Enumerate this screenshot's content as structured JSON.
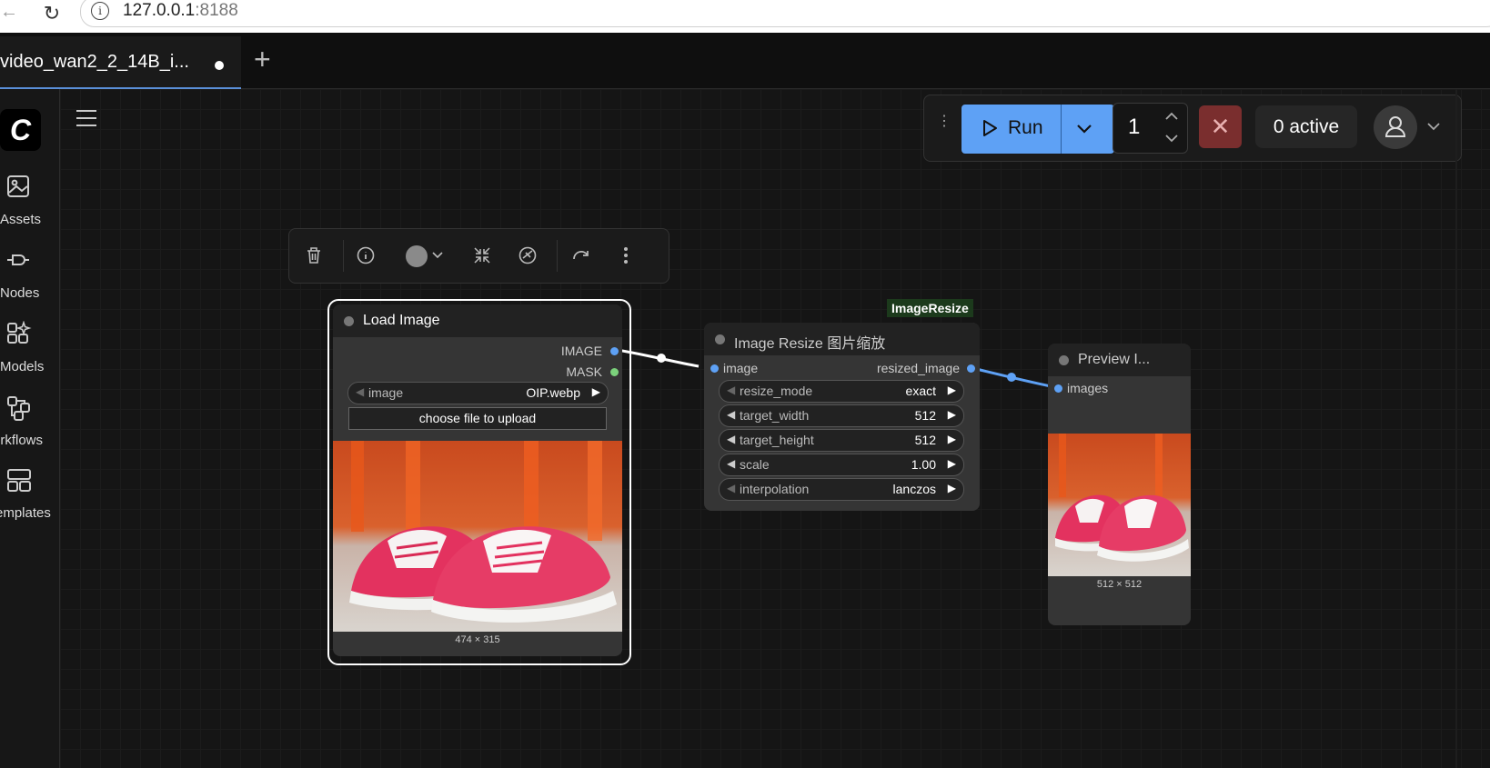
{
  "browser": {
    "url_host": "127.0.0.1",
    "url_port": ":8188"
  },
  "tabs": [
    {
      "title": "video_wan2_2_14B_i..."
    }
  ],
  "sidebar": {
    "items": [
      {
        "label": "Assets"
      },
      {
        "label": "Nodes"
      },
      {
        "label": "Models"
      },
      {
        "label": "orkflows"
      },
      {
        "label": "emplates"
      }
    ]
  },
  "toolbar": {
    "run_label": "Run",
    "queue_count": "1",
    "active_label": "0 active"
  },
  "nodes": {
    "load_image": {
      "title": "Load Image",
      "outputs": [
        "IMAGE",
        "MASK"
      ],
      "image_widget": {
        "name": "image",
        "value": "OIP.webp"
      },
      "upload_label": "choose file to upload",
      "dims": "474 × 315"
    },
    "image_resize": {
      "badge": "ImageResize",
      "title": "Image Resize 图片缩放",
      "input": "image",
      "output": "resized_image",
      "widgets": [
        {
          "name": "resize_mode",
          "value": "exact"
        },
        {
          "name": "target_width",
          "value": "512"
        },
        {
          "name": "target_height",
          "value": "512"
        },
        {
          "name": "scale",
          "value": "1.00"
        },
        {
          "name": "interpolation",
          "value": "lanczos"
        }
      ]
    },
    "preview": {
      "title": "Preview I...",
      "input": "images",
      "dims": "512 × 512"
    }
  },
  "colors": {
    "accent": "#5ea1f5",
    "link_image": "#5ea1f5",
    "link_mask": "#7bd17b"
  }
}
